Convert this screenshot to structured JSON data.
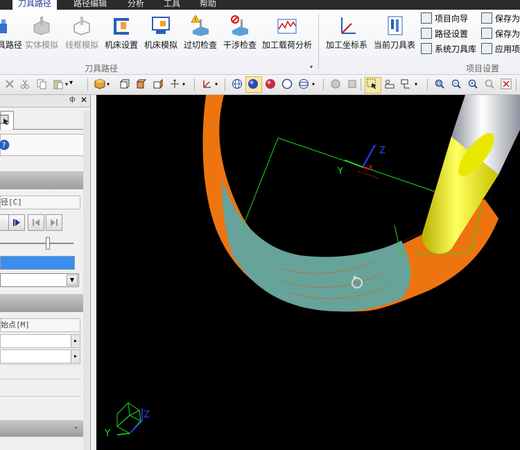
{
  "menu": {
    "items": [
      {
        "label": "刀具路径",
        "active": true
      },
      {
        "label": "路径编辑",
        "active": false
      },
      {
        "label": "分析",
        "active": false
      },
      {
        "label": "工具",
        "active": false
      },
      {
        "label": "帮助",
        "active": false
      }
    ]
  },
  "ribbon": {
    "toolpath_group": {
      "label": "刀具路径",
      "buttons": [
        "具路径",
        "实体模拟",
        "线框模拟",
        "机床设置",
        "机床模拟",
        "过切检查",
        "干涉检查",
        "加工载荷分析"
      ]
    },
    "project_group": {
      "label": "项目设置",
      "buttons": [
        "加工坐标系",
        "当前刀具表"
      ],
      "small_col1": [
        "项目向导",
        "路径设置",
        "系统刀具库"
      ],
      "small_col2": [
        "保存为",
        "保存为",
        "应用项"
      ]
    }
  },
  "left_panel": {
    "pin_glyph": "ф",
    "close_glyph": "✕",
    "field_path": "径[C]",
    "field_start": "始点[M]",
    "progress_fraction": 1.0
  },
  "viewport": {
    "axis_labels": {
      "x": "X",
      "y": "Y",
      "z": "Z"
    },
    "colors": {
      "part": "#ee7410",
      "machined": "#5fa7a4",
      "tool_tip": "#f2f000",
      "tool_shank": "#c4c8d0",
      "box": "#22dd22"
    }
  }
}
